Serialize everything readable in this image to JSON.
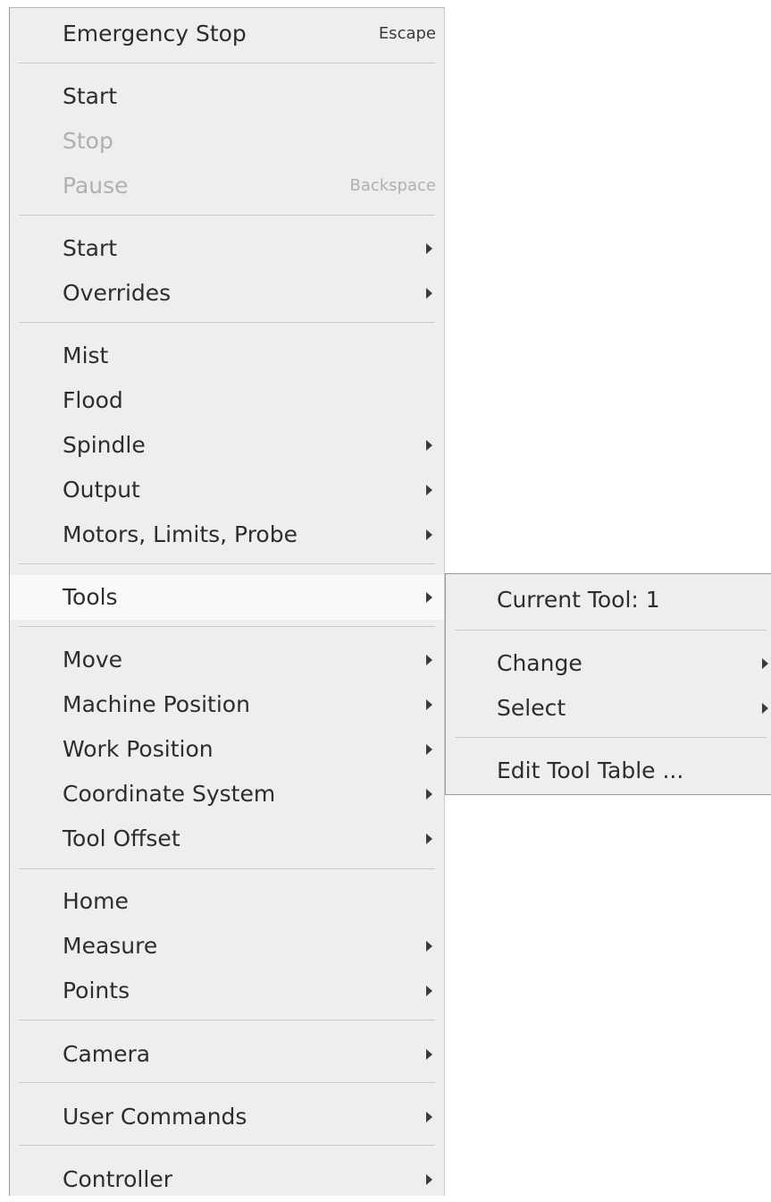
{
  "main_menu": {
    "emergency_stop": {
      "label": "Emergency Stop",
      "shortcut": "Escape"
    },
    "start": {
      "label": "Start"
    },
    "stop": {
      "label": "Stop"
    },
    "pause": {
      "label": "Pause",
      "shortcut": "Backspace"
    },
    "start_sub": {
      "label": "Start"
    },
    "overrides": {
      "label": "Overrides"
    },
    "mist": {
      "label": "Mist"
    },
    "flood": {
      "label": "Flood"
    },
    "spindle": {
      "label": "Spindle"
    },
    "output": {
      "label": "Output"
    },
    "motors_limits_probe": {
      "label": "Motors, Limits, Probe"
    },
    "tools": {
      "label": "Tools"
    },
    "move": {
      "label": "Move"
    },
    "machine_position": {
      "label": "Machine Position"
    },
    "work_position": {
      "label": "Work Position"
    },
    "coordinate_system": {
      "label": "Coordinate System"
    },
    "tool_offset": {
      "label": "Tool Offset"
    },
    "home": {
      "label": "Home"
    },
    "measure": {
      "label": "Measure"
    },
    "points": {
      "label": "Points"
    },
    "camera": {
      "label": "Camera"
    },
    "user_commands": {
      "label": "User Commands"
    },
    "controller": {
      "label": "Controller"
    }
  },
  "tools_submenu": {
    "current_tool": {
      "label": "Current Tool: 1"
    },
    "change": {
      "label": "Change"
    },
    "select": {
      "label": "Select"
    },
    "edit_tool_table": {
      "label": "Edit Tool Table ..."
    }
  },
  "colors": {
    "menu_background": "#eeeeee",
    "highlight_background": "#fafafa",
    "text": "#2d2d2d",
    "disabled_text": "#b0b0b0",
    "separator": "#c9c9c9"
  }
}
